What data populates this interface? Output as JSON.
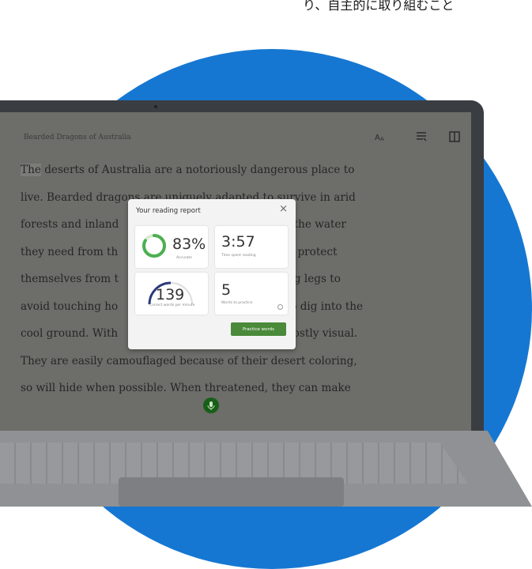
{
  "caption": {
    "text": "り、自主的に取り組むこと"
  },
  "reader": {
    "book_title": "Bearded Dragons of Australia",
    "icons": {
      "text_options": "text-options-icon",
      "reading_prefs": "reading-preferences-icon",
      "book": "book-icon"
    },
    "lines": [
      "The deserts of Australia are a notoriously dangerous place to",
      "live. Bearded dragons are uniquely adapted to survive in arid",
      "forests and inland",
      "l of the water",
      "they need from th",
      ". To protect",
      "themselves from t",
      "ong legs to",
      "avoid touching ho",
      "o dig into the",
      "cool ground. With",
      "is mostly visual.",
      "They are easily camouflaged because of their desert coloring,",
      "so will hide when possible. When threatened, they can make"
    ]
  },
  "report": {
    "title": "Your reading report",
    "close_label": "×",
    "cards": {
      "accuracy": {
        "value": "83%",
        "label": "Accurate",
        "progress": 0.83
      },
      "time": {
        "value": "3:57",
        "label": "Time spent reading"
      },
      "wpm": {
        "value": "139",
        "label": "Correct words per minute"
      },
      "words": {
        "value": "5",
        "label": "Words to practice"
      }
    },
    "practice_button": "Practice words"
  },
  "colors": {
    "accent_blue": "#1677d2",
    "green": "#4a8a3a",
    "mic_green": "#175f18"
  }
}
